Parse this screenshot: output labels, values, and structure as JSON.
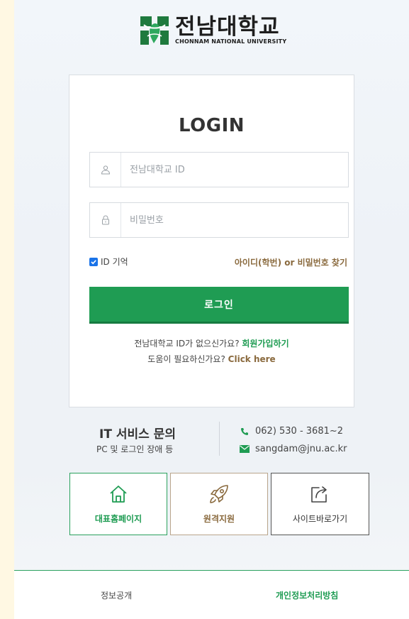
{
  "logo": {
    "name_kr": "전남대학교",
    "name_en": "CHONNAM NATIONAL UNIVERSITY",
    "brand_color": "#1f9c53"
  },
  "login": {
    "title": "LOGIN",
    "id_field": {
      "placeholder": "전남대학교 ID",
      "value": "",
      "icon": "user-icon"
    },
    "password_field": {
      "placeholder": "비밀번호",
      "value": "",
      "icon": "lock-icon"
    },
    "remember_label": "ID 기억",
    "remember_checked": true,
    "find_link": "아이디(학번) or 비밀번호 찾기",
    "submit_label": "로그인",
    "signup_prompt": "전남대학교 ID가 없으신가요?",
    "signup_link": "회원가입하기",
    "help_prompt": "도움이 필요하신가요?",
    "help_link": "Click here"
  },
  "it_service": {
    "title": "IT 서비스 문의",
    "subtitle": "PC 및 로그인 장애 등",
    "phone": "062) 530 - 3681~2",
    "email": "sangdam@jnu.ac.kr"
  },
  "quick_links": [
    {
      "label": "대표홈페이지",
      "icon": "home-icon",
      "color": "#1f9c53"
    },
    {
      "label": "원격지원",
      "icon": "rocket-icon",
      "color": "#8a6a3e"
    },
    {
      "label": "사이트바로가기",
      "icon": "external-link-icon",
      "color": "#333333"
    }
  ],
  "footer": {
    "left_link": "정보공개",
    "right_link": "개인정보처리방침"
  }
}
